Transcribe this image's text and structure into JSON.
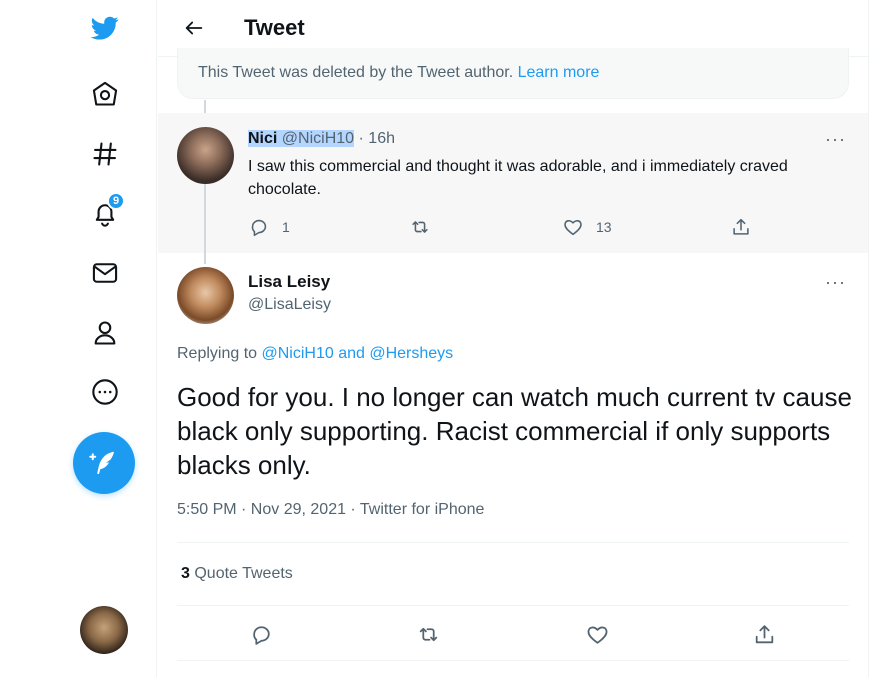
{
  "sidebar": {
    "icons": [
      "twitter-logo-icon",
      "home-icon",
      "explore-hashtag-icon",
      "notifications-bell-icon",
      "messages-mail-icon",
      "profile-person-icon",
      "more-dots-icon"
    ],
    "notifications_badge": "9",
    "compose_icon": "compose-feather-icon"
  },
  "header": {
    "title": "Tweet"
  },
  "deleted_notice": {
    "text": "This Tweet was deleted by the Tweet author.",
    "link": "Learn more"
  },
  "parent_tweet": {
    "name": "Nici",
    "handle": "@NiciH10",
    "time": "· 16h",
    "text": "I saw this commercial and thought it was adorable, and i immediately craved chocolate.",
    "reply_count": "1",
    "retweet_count": "",
    "like_count": "13",
    "more": "···"
  },
  "main_tweet": {
    "name": "Lisa Leisy",
    "handle": "@LisaLeisy",
    "replying_prefix": "Replying to",
    "replying_mentions": "@NiciH10 and @Hersheys",
    "text": "Good for you. I no longer can watch much current tv cause black only supporting. Racist commercial if only supports blacks only.",
    "meta": "5:50 PM · Nov 29, 2021 · Twitter for iPhone",
    "quote_count": "3",
    "quote_label": "Quote Tweets",
    "more": "···"
  },
  "colors": {
    "accent": "#1d9bf0",
    "text": "#0f1419",
    "muted": "#536471",
    "highlight": "#b4d5fe"
  }
}
